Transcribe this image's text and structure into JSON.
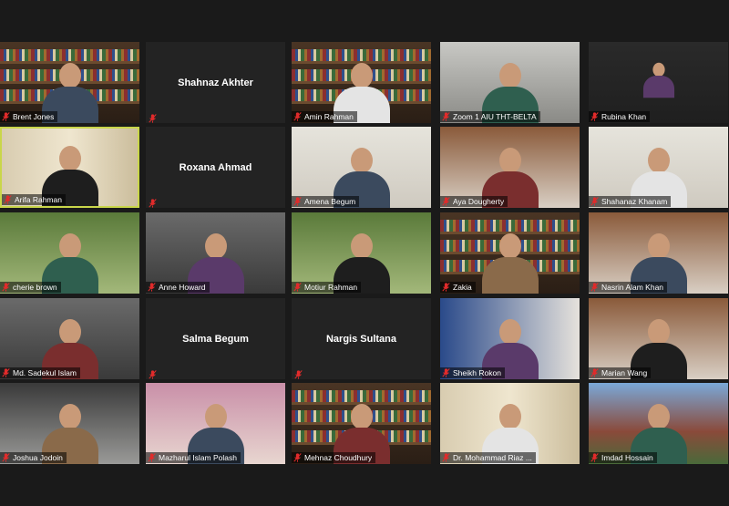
{
  "meeting": {
    "rows": [
      [
        {
          "name": "Brent Jones",
          "video": true,
          "scene": "bookshelf"
        },
        {
          "name": "Shahnaz Akhter",
          "video": false
        },
        {
          "name": "Amin Rahman",
          "video": true,
          "scene": "bookshelf"
        },
        {
          "name": "Zoom 1 AIU THT-BELTA",
          "video": true,
          "scene": "studio"
        },
        {
          "name": "Rubina Khan",
          "video": true,
          "scene": "dark-small"
        }
      ],
      [
        {
          "name": "Arifa Rahman",
          "video": true,
          "scene": "curtain",
          "active": true
        },
        {
          "name": "Roxana Ahmad",
          "video": false
        },
        {
          "name": "Amena Begum",
          "video": true,
          "scene": "white-room"
        },
        {
          "name": "Aya Dougherty",
          "video": true,
          "scene": "room"
        },
        {
          "name": "Shahanaz Khanam",
          "video": true,
          "scene": "white-room"
        }
      ],
      [
        {
          "name": "cherie brown",
          "video": true,
          "scene": "garden"
        },
        {
          "name": "Anne Howard",
          "video": true,
          "scene": "grey"
        },
        {
          "name": "Motiur Rahman",
          "video": true,
          "scene": "garden"
        },
        {
          "name": "Zakia",
          "video": true,
          "scene": "bookshelf"
        },
        {
          "name": "Nasrin Alam Khan",
          "video": true,
          "scene": "room"
        }
      ],
      [
        {
          "name": "Md. Sadekul Islam",
          "video": true,
          "scene": "grey"
        },
        {
          "name": "Salma Begum",
          "video": false
        },
        {
          "name": "Nargis Sultana",
          "video": false
        },
        {
          "name": "Sheikh Rokon",
          "video": true,
          "scene": "blue"
        },
        {
          "name": "Marian Wang",
          "video": true,
          "scene": "room"
        }
      ],
      [
        {
          "name": "Joshua Jodoin",
          "video": true,
          "scene": "glass"
        },
        {
          "name": "Mazharul Islam Polash",
          "video": true,
          "scene": "pink"
        },
        {
          "name": "Mehnaz Choudhury",
          "video": true,
          "scene": "bookshelf"
        },
        {
          "name": "Dr. Mohammad Riaz ...",
          "video": true,
          "scene": "curtain"
        },
        {
          "name": "Imdad Hossain",
          "video": true,
          "scene": "campus"
        }
      ]
    ],
    "muted_icon": "microphone-muted-icon",
    "active_speaker_color": "#c9d64a",
    "mute_color": "#e02b2b"
  }
}
